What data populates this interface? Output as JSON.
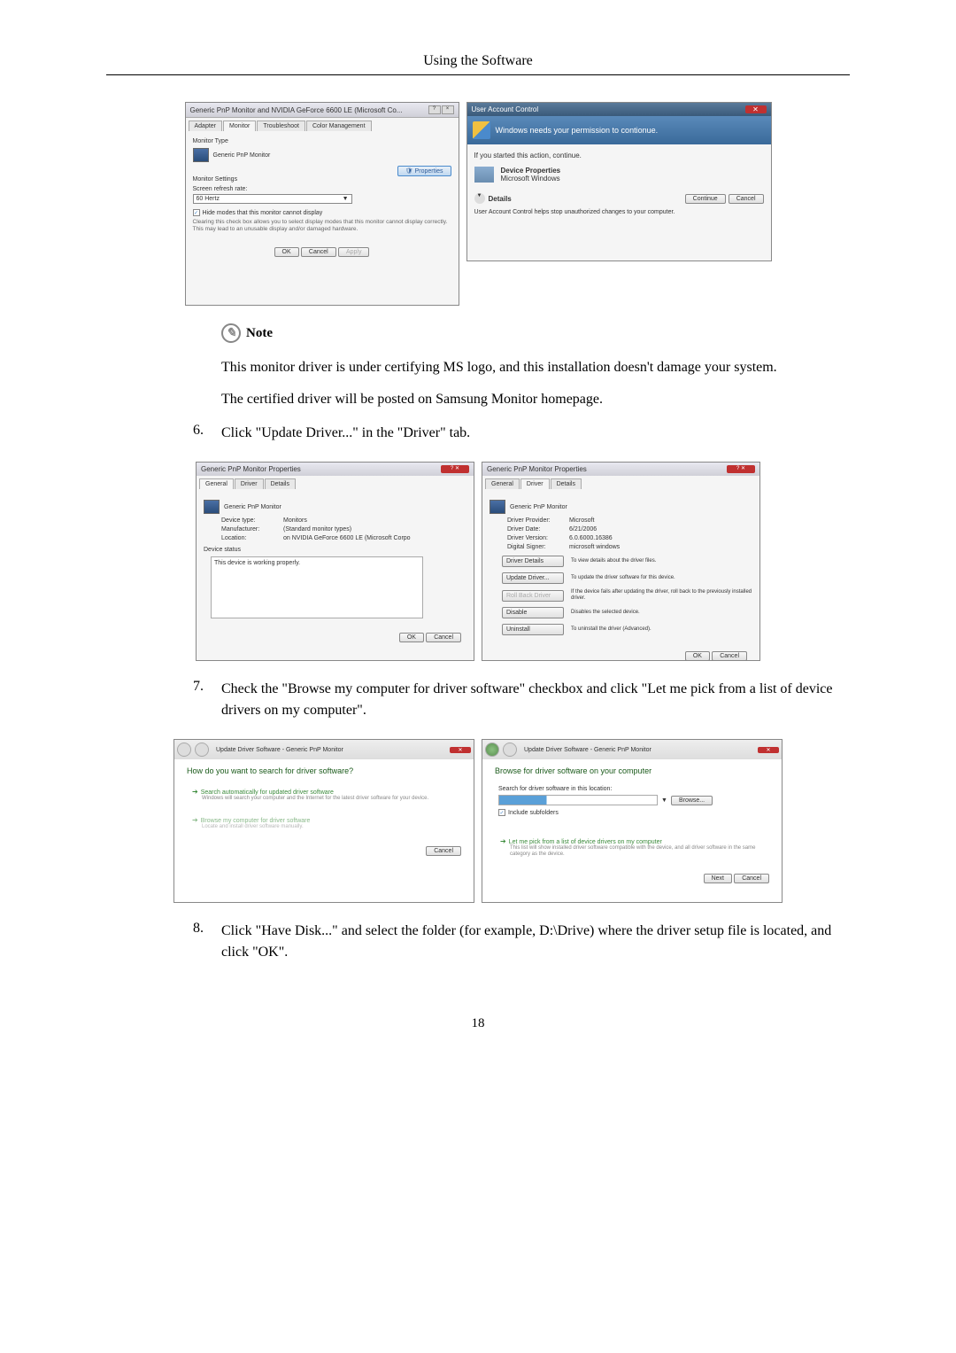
{
  "page": {
    "header": "Using the Software",
    "number": "18"
  },
  "note": {
    "label": "Note",
    "line1": "This monitor driver is under certifying MS logo, and this installation doesn't damage your system.",
    "line2": "The certified driver will be posted on Samsung Monitor homepage."
  },
  "steps": {
    "s6num": "6.",
    "s6": "Click \"Update Driver...\" in the \"Driver\" tab.",
    "s7num": "7.",
    "s7": "Check the \"Browse my computer for driver software\" checkbox and click \"Let me pick from a list of device drivers on my computer\".",
    "s8num": "8.",
    "s8": "Click \"Have Disk...\" and select the folder (for example, D:\\Drive) where the driver setup file is located, and click \"OK\"."
  },
  "dlg1": {
    "title": "Generic PnP Monitor and NVIDIA GeForce 6600 LE (Microsoft Co...",
    "tab_adapter": "Adapter",
    "tab_monitor": "Monitor",
    "tab_troubleshoot": "Troubleshoot",
    "tab_color": "Color Management",
    "monitor_type": "Monitor Type",
    "monitor_name": "Generic PnP Monitor",
    "properties": "Properties",
    "monitor_settings": "Monitor Settings",
    "refresh_label": "Screen refresh rate:",
    "refresh_value": "60 Hertz",
    "hide_modes": "Hide modes that this monitor cannot display",
    "hide_desc": "Clearing this check box allows you to select display modes that this monitor cannot display correctly. This may lead to an unusable display and/or damaged hardware.",
    "ok": "OK",
    "cancel": "Cancel",
    "apply": "Apply"
  },
  "uac": {
    "title": "User Account Control",
    "heading": "Windows needs your permission to contionue.",
    "started": "If you started this action, continue.",
    "item1": "Device Properties",
    "item2": "Microsoft Windows",
    "details": "Details",
    "continue": "Continue",
    "cancel": "Cancel",
    "footer": "User Account Control helps stop unauthorized changes to your computer."
  },
  "dlg3": {
    "title": "Generic PnP Monitor Properties",
    "tab_general": "General",
    "tab_driver": "Driver",
    "tab_details": "Details",
    "monitor_name": "Generic PnP Monitor",
    "devtype_label": "Device type:",
    "devtype": "Monitors",
    "mfr_label": "Manufacturer:",
    "mfr": "(Standard monitor types)",
    "loc_label": "Location:",
    "loc": "on NVIDIA GeForce 6600 LE (Microsoft Corpo",
    "status_label": "Device status",
    "status": "This device is working properly.",
    "ok": "OK",
    "cancel": "Cancel"
  },
  "dlg4": {
    "title": "Generic PnP Monitor Properties",
    "tab_general": "General",
    "tab_driver": "Driver",
    "tab_details": "Details",
    "monitor_name": "Generic PnP Monitor",
    "provider_label": "Driver Provider:",
    "provider": "Microsoft",
    "date_label": "Driver Date:",
    "date": "6/21/2006",
    "version_label": "Driver Version:",
    "version": "6.0.6000.16386",
    "signer_label": "Digital Signer:",
    "signer": "microsoft windows",
    "btn_details": "Driver Details",
    "btn_details_desc": "To view details about the driver files.",
    "btn_update": "Update Driver...",
    "btn_update_desc": "To update the driver software for this device.",
    "btn_rollback": "Roll Back Driver",
    "btn_rollback_desc": "If the device fails after updating the driver, roll back to the previously installed driver.",
    "btn_disable": "Disable",
    "btn_disable_desc": "Disables the selected device.",
    "btn_uninstall": "Uninstall",
    "btn_uninstall_desc": "To uninstall the driver (Advanced).",
    "ok": "OK",
    "cancel": "Cancel"
  },
  "wiz1": {
    "breadcrumb": "Update Driver Software - Generic PnP Monitor",
    "heading": "How do you want to search for driver software?",
    "opt1_title": "Search automatically for updated driver software",
    "opt1_desc": "Windows will search your computer and the Internet for the latest driver software for your device.",
    "opt2_title": "Browse my computer for driver software",
    "opt2_desc": "Locate and install driver software manually.",
    "cancel": "Cancel"
  },
  "wiz2": {
    "breadcrumb": "Update Driver Software - Generic PnP Monitor",
    "heading": "Browse for driver software on your computer",
    "search_label": "Search for driver software in this location:",
    "browse": "Browse...",
    "include": "Include subfolders",
    "opt_title": "Let me pick from a list of device drivers on my computer",
    "opt_desc": "This list will show installed driver software compatible with the device, and all driver software in the same category as the device.",
    "next": "Next",
    "cancel": "Cancel"
  }
}
